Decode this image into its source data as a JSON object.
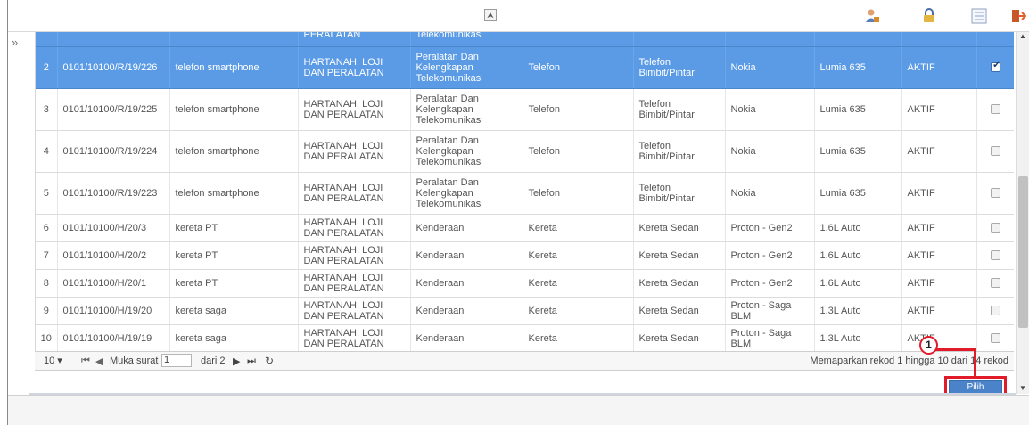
{
  "toolbar": {
    "collapse_glyph": "⮝",
    "icons": [
      "user-icon",
      "lock-icon",
      "list-icon",
      "exit-icon"
    ]
  },
  "nav": {
    "expand_glyph": "»"
  },
  "table": {
    "rows": [
      {
        "num": "",
        "id": "",
        "name": "",
        "category": "PERALATAN",
        "group": "Telekomunikasi",
        "type": "",
        "subtype": "",
        "brand": "",
        "model": "",
        "status": "",
        "checked": true,
        "selected": true,
        "cut": true
      },
      {
        "num": "2",
        "id": "0101/10100/R/19/226",
        "name": "telefon smartphone",
        "category": "HARTANAH, LOJI DAN PERALATAN",
        "group": "Peralatan Dan Kelengkapan Telekomunikasi",
        "type": "Telefon",
        "subtype": "Telefon Bimbit/Pintar",
        "brand": "Nokia",
        "model": "Lumia 635",
        "status": "AKTIF",
        "checked": true,
        "selected": true
      },
      {
        "num": "3",
        "id": "0101/10100/R/19/225",
        "name": "telefon smartphone",
        "category": "HARTANAH, LOJI DAN PERALATAN",
        "group": "Peralatan Dan Kelengkapan Telekomunikasi",
        "type": "Telefon",
        "subtype": "Telefon Bimbit/Pintar",
        "brand": "Nokia",
        "model": "Lumia 635",
        "status": "AKTIF",
        "checked": false
      },
      {
        "num": "4",
        "id": "0101/10100/R/19/224",
        "name": "telefon smartphone",
        "category": "HARTANAH, LOJI DAN PERALATAN",
        "group": "Peralatan Dan Kelengkapan Telekomunikasi",
        "type": "Telefon",
        "subtype": "Telefon Bimbit/Pintar",
        "brand": "Nokia",
        "model": "Lumia 635",
        "status": "AKTIF",
        "checked": false
      },
      {
        "num": "5",
        "id": "0101/10100/R/19/223",
        "name": "telefon smartphone",
        "category": "HARTANAH, LOJI DAN PERALATAN",
        "group": "Peralatan Dan Kelengkapan Telekomunikasi",
        "type": "Telefon",
        "subtype": "Telefon Bimbit/Pintar",
        "brand": "Nokia",
        "model": "Lumia 635",
        "status": "AKTIF",
        "checked": false
      },
      {
        "num": "6",
        "id": "0101/10100/H/20/3",
        "name": "kereta PT",
        "category": "HARTANAH, LOJI DAN PERALATAN",
        "group": "Kenderaan",
        "type": "Kereta",
        "subtype": "Kereta Sedan",
        "brand": "Proton - Gen2",
        "model": "1.6L Auto",
        "status": "AKTIF",
        "checked": false
      },
      {
        "num": "7",
        "id": "0101/10100/H/20/2",
        "name": "kereta PT",
        "category": "HARTANAH, LOJI DAN PERALATAN",
        "group": "Kenderaan",
        "type": "Kereta",
        "subtype": "Kereta Sedan",
        "brand": "Proton - Gen2",
        "model": "1.6L Auto",
        "status": "AKTIF",
        "checked": false
      },
      {
        "num": "8",
        "id": "0101/10100/H/20/1",
        "name": "kereta PT",
        "category": "HARTANAH, LOJI DAN PERALATAN",
        "group": "Kenderaan",
        "type": "Kereta",
        "subtype": "Kereta Sedan",
        "brand": "Proton - Gen2",
        "model": "1.6L Auto",
        "status": "AKTIF",
        "checked": false
      },
      {
        "num": "9",
        "id": "0101/10100/H/19/20",
        "name": "kereta saga",
        "category": "HARTANAH, LOJI DAN PERALATAN",
        "group": "Kenderaan",
        "type": "Kereta",
        "subtype": "Kereta Sedan",
        "brand": "Proton - Saga BLM",
        "model": "1.3L Auto",
        "status": "AKTIF",
        "checked": false
      },
      {
        "num": "10",
        "id": "0101/10100/H/19/19",
        "name": "kereta saga",
        "category": "HARTANAH, LOJI DAN PERALATAN",
        "group": "Kenderaan",
        "type": "Kereta",
        "subtype": "Kereta Sedan",
        "brand": "Proton - Saga BLM",
        "model": "1.3L Auto",
        "status": "AKTIF",
        "checked": false
      }
    ]
  },
  "pager": {
    "page_size": "10 ▾",
    "first_glyph": "⏮",
    "prev_glyph": "◀",
    "page_label": "Muka surat",
    "page_value": "1",
    "of_label": "dari 2",
    "next_glyph": "▶",
    "last_glyph": "⏭",
    "refresh_glyph": "↻",
    "info": "Memaparkan rekod 1 hingga 10 dari 14 rekod"
  },
  "actions": {
    "pilih_label": "Pilih"
  },
  "annotation": {
    "badge": "1",
    "color": "#e21b2b"
  },
  "colors": {
    "selected_row": "#5b9be5",
    "button": "#4a83c9"
  }
}
